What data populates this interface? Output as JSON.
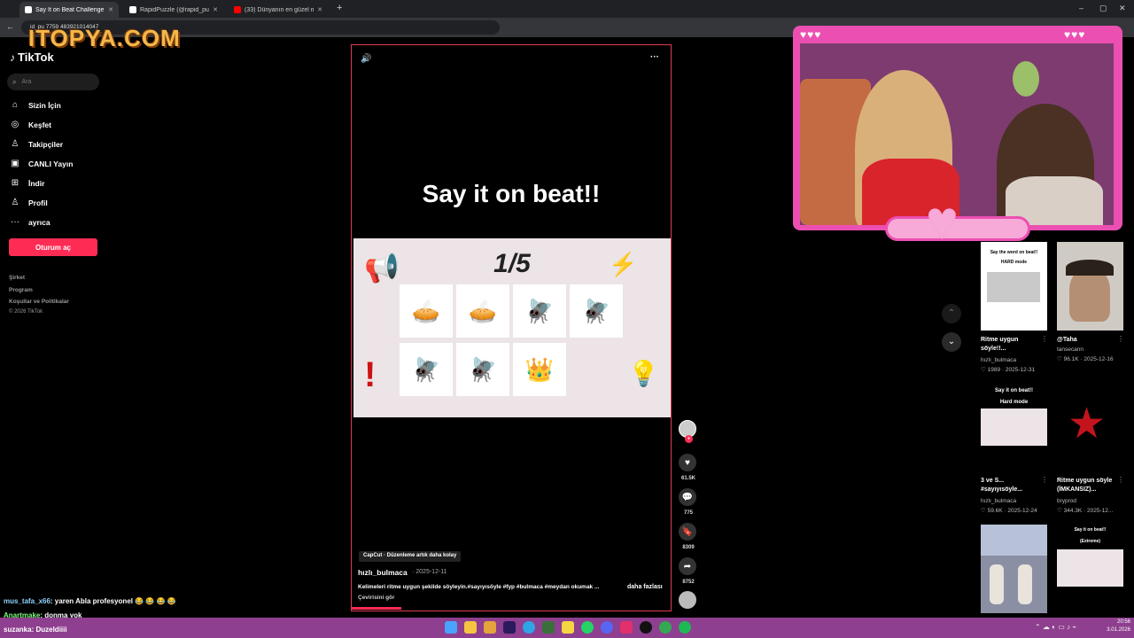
{
  "browser": {
    "tabs": [
      {
        "label": "Say It on Beat Challenge: Join t"
      },
      {
        "label": "RapidPuzzle (@rapid_puzzle) | "
      },
      {
        "label": "(33) Dünyanın en güzel makya"
      }
    ],
    "new_tab": "+",
    "url": "id_pu        7759       483921014047",
    "window_controls": [
      "–",
      "▢",
      "✕"
    ]
  },
  "watermark": "ITOPYA.COM",
  "tiktok": {
    "logo": "TikTok",
    "search_placeholder": "Ara",
    "nav": [
      {
        "label": "Sizin İçin",
        "icon": "home-icon"
      },
      {
        "label": "Keşfet",
        "icon": "compass-icon"
      },
      {
        "label": "Takipçiler",
        "icon": "user-icon"
      },
      {
        "label": "CANLI Yayın",
        "icon": "live-icon"
      },
      {
        "label": "İndir",
        "icon": "download-icon"
      },
      {
        "label": "Profil",
        "icon": "profile-icon"
      },
      {
        "label": "ayrıca",
        "icon": "more-icon"
      }
    ],
    "login_button": "Oturum aç",
    "footer": [
      "Şirket",
      "Program",
      "Koşullar ve Politikalar",
      "© 2026 TikTok"
    ]
  },
  "video": {
    "headline": "Say it on beat!!",
    "counter": "1/5",
    "capcut_tag": "CapCut · Düzenleme artık daha kolay",
    "author": "hızlı_bulmaca",
    "date": "· 2025-12-11",
    "description": "Kelimeleri ritme uygun şekilde söyleyin.#sayıyısöyle #fyp #bulmaca #meydan okumak ...",
    "more": "daha fazlası",
    "translate": "Çevirisini gör",
    "likes": "61.5K",
    "comments": "775",
    "saves": "8309",
    "shares": "8752"
  },
  "recommended": [
    {
      "title": "Ritme uygun söyle!!...",
      "user": "hızlı_bulmaca",
      "stats": "♡ 1989 · 2025-12-31",
      "thumb_top": "Say the word on beat!!",
      "thumb_sub": "HARD mode"
    },
    {
      "title": "@Taha",
      "user": "tansecann",
      "stats": "♡ 96.1K · 2025-12-16",
      "thumb_top": "",
      "thumb_sub": ""
    },
    {
      "title": "3 ve S... #sayıyısöyle...",
      "user": "hızlı_bulmaca",
      "stats": "♡ 59.6K · 2025-12-24",
      "thumb_top": "Say it on beat!!",
      "thumb_sub": "Hard mode"
    },
    {
      "title": "Ritme uygun söyle (İMKANSIZ)...",
      "user": "bryprod",
      "stats": "♡ 344.3K · 2025-12...",
      "thumb_top": "",
      "thumb_sub": ""
    },
    {
      "title": "",
      "user": "",
      "stats": "",
      "thumb_top": "",
      "thumb_sub": ""
    },
    {
      "title": "",
      "user": "",
      "stats": "",
      "thumb_top": "Say it on beat!!",
      "thumb_sub": "(Extreme)"
    }
  ],
  "chat": [
    {
      "user": "mus_tafa_x66",
      "msg": ": yaren Abla profesyonel 😂 😂 😂 😂",
      "color": "#8fd3ff"
    },
    {
      "user": "Anartmake",
      "msg": ": donma yok",
      "color": "#7cff7c"
    },
    {
      "user": "suzanka",
      "msg": ": Duzeldiiii",
      "color": "#ffffff"
    }
  ],
  "taskbar": {
    "time": "20:56",
    "date": "3.01.2026"
  },
  "colors": {
    "accent": "#fe2c55",
    "cam_border": "#ec4fb2",
    "taskbar": "#8e3f8f"
  }
}
